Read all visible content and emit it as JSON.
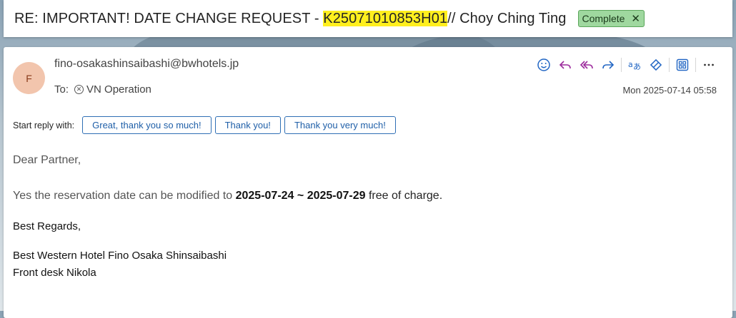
{
  "subject": {
    "prefix": "RE: IMPORTANT! DATE CHANGE REQUEST - ",
    "highlight": "K25071010853H01",
    "suffix": "// Choy Ching Ting"
  },
  "category_badge": {
    "label": "Complete",
    "close": "✕",
    "color": "#9fd89f"
  },
  "message": {
    "avatar_initial": "F",
    "from": "fino-osakashinsaibashi@bwhotels.jp",
    "to_label": "To:",
    "to_recipient": "VN Operation",
    "date": "Mon 2025-07-14 05:58"
  },
  "toolbar": {
    "icons": [
      "emoji-icon",
      "reply-icon",
      "reply-all-icon",
      "forward-icon",
      "translate-icon",
      "immersive-reader-icon",
      "apps-icon",
      "more-icon"
    ]
  },
  "quick_reply": {
    "label": "Start reply with:",
    "options": [
      "Great, thank you so much!",
      "Thank you!",
      "Thank you very much!"
    ]
  },
  "body": {
    "greeting": "Dear Partner,",
    "line_prefix": "Yes the reservation date can be modified to ",
    "dates": "2025-07-24 ~ 2025-07-29",
    "line_suffix": " free of charge.",
    "closing": "Best Regards,",
    "signature_line1": "Best Western Hotel Fino Osaka Shinsaibashi",
    "signature_line2": "Front desk Nikola"
  }
}
